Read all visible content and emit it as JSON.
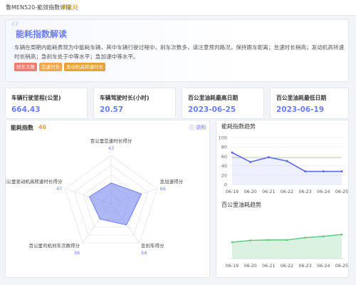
{
  "window": {
    "title": "鲁MEN520-能效指数详情",
    "level": "中能耗"
  },
  "intro": {
    "title": "能耗指数解读",
    "body": "车辆在周期内能耗表现为中能耗车辆，其中车辆行驶过程中，刹车次数多，请注意预判路况，保持跟车距离；怠速时长稍高；发动机高转速时长稍高；急刹车处于中等水平；急加速中等水平。",
    "tags": [
      "刹车次数",
      "怠速时长",
      "发动机高转速时长"
    ]
  },
  "stats": [
    {
      "label": "车辆行驶里程(公里)",
      "value": "664.43"
    },
    {
      "label": "车辆驾驶时长(小时)",
      "value": "20.57"
    },
    {
      "label": "百公里油耗最高日期",
      "value": "2023-06-25"
    },
    {
      "label": "百公里油耗最低日期",
      "value": "2023-06-19"
    }
  ],
  "energy_panel": {
    "title": "能耗指数",
    "score": "46",
    "explain": "说明",
    "radar": [
      {
        "label": "百公里怠速时长得分",
        "value": 43
      },
      {
        "label": "急加速得分",
        "value": 66
      },
      {
        "label": "急刹车得分",
        "value": 54
      },
      {
        "label": "百公里司机刹车次数得分",
        "value": 39
      },
      {
        "label": "百公里发动机高转速时长得分",
        "value": 47
      }
    ],
    "radar_max": 100
  },
  "trend_panel": {
    "title1": "能耗指数趋势",
    "title2": "百公里油耗趋势"
  },
  "chart_data": [
    {
      "type": "line",
      "title": "能耗指数趋势",
      "x": [
        "06-19",
        "06-20",
        "06-21",
        "06-22",
        "06-23",
        "06-24",
        "06-25"
      ],
      "series": [
        {
          "values": [
            68,
            48,
            58,
            50,
            28,
            28,
            28
          ]
        },
        {
          "values": [
            57,
            57,
            57,
            57,
            57,
            57,
            57
          ]
        }
      ],
      "ylim": [
        0,
        100
      ],
      "yticks": [
        "0",
        "20",
        "40",
        "60",
        "80",
        "100"
      ],
      "colors": [
        "#5b6ae8",
        "#f0b5aa"
      ]
    },
    {
      "type": "area",
      "title": "百公里油耗趋势",
      "x": [
        "06-19",
        "06-20",
        "06-21",
        "06-22",
        "06-23",
        "06-24",
        "06-25"
      ],
      "series": [
        {
          "values": [
            0.36,
            0.4,
            0.41,
            0.41,
            0.46,
            0.49,
            0.53
          ]
        }
      ],
      "ylim": [
        0,
        1
      ],
      "colors": [
        "#5cc37e"
      ]
    }
  ]
}
